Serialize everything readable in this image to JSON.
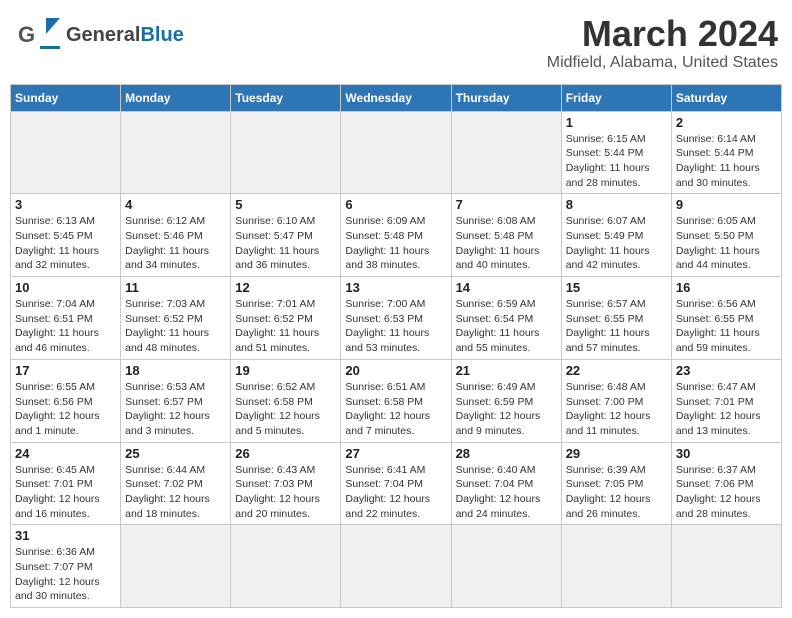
{
  "header": {
    "logo_general": "General",
    "logo_blue": "Blue",
    "month_title": "March 2024",
    "location": "Midfield, Alabama, United States"
  },
  "weekdays": [
    "Sunday",
    "Monday",
    "Tuesday",
    "Wednesday",
    "Thursday",
    "Friday",
    "Saturday"
  ],
  "weeks": [
    [
      {
        "day": "",
        "info": ""
      },
      {
        "day": "",
        "info": ""
      },
      {
        "day": "",
        "info": ""
      },
      {
        "day": "",
        "info": ""
      },
      {
        "day": "",
        "info": ""
      },
      {
        "day": "1",
        "info": "Sunrise: 6:15 AM\nSunset: 5:44 PM\nDaylight: 11 hours\nand 28 minutes."
      },
      {
        "day": "2",
        "info": "Sunrise: 6:14 AM\nSunset: 5:44 PM\nDaylight: 11 hours\nand 30 minutes."
      }
    ],
    [
      {
        "day": "3",
        "info": "Sunrise: 6:13 AM\nSunset: 5:45 PM\nDaylight: 11 hours\nand 32 minutes."
      },
      {
        "day": "4",
        "info": "Sunrise: 6:12 AM\nSunset: 5:46 PM\nDaylight: 11 hours\nand 34 minutes."
      },
      {
        "day": "5",
        "info": "Sunrise: 6:10 AM\nSunset: 5:47 PM\nDaylight: 11 hours\nand 36 minutes."
      },
      {
        "day": "6",
        "info": "Sunrise: 6:09 AM\nSunset: 5:48 PM\nDaylight: 11 hours\nand 38 minutes."
      },
      {
        "day": "7",
        "info": "Sunrise: 6:08 AM\nSunset: 5:48 PM\nDaylight: 11 hours\nand 40 minutes."
      },
      {
        "day": "8",
        "info": "Sunrise: 6:07 AM\nSunset: 5:49 PM\nDaylight: 11 hours\nand 42 minutes."
      },
      {
        "day": "9",
        "info": "Sunrise: 6:05 AM\nSunset: 5:50 PM\nDaylight: 11 hours\nand 44 minutes."
      }
    ],
    [
      {
        "day": "10",
        "info": "Sunrise: 7:04 AM\nSunset: 6:51 PM\nDaylight: 11 hours\nand 46 minutes."
      },
      {
        "day": "11",
        "info": "Sunrise: 7:03 AM\nSunset: 6:52 PM\nDaylight: 11 hours\nand 48 minutes."
      },
      {
        "day": "12",
        "info": "Sunrise: 7:01 AM\nSunset: 6:52 PM\nDaylight: 11 hours\nand 51 minutes."
      },
      {
        "day": "13",
        "info": "Sunrise: 7:00 AM\nSunset: 6:53 PM\nDaylight: 11 hours\nand 53 minutes."
      },
      {
        "day": "14",
        "info": "Sunrise: 6:59 AM\nSunset: 6:54 PM\nDaylight: 11 hours\nand 55 minutes."
      },
      {
        "day": "15",
        "info": "Sunrise: 6:57 AM\nSunset: 6:55 PM\nDaylight: 11 hours\nand 57 minutes."
      },
      {
        "day": "16",
        "info": "Sunrise: 6:56 AM\nSunset: 6:55 PM\nDaylight: 11 hours\nand 59 minutes."
      }
    ],
    [
      {
        "day": "17",
        "info": "Sunrise: 6:55 AM\nSunset: 6:56 PM\nDaylight: 12 hours\nand 1 minute."
      },
      {
        "day": "18",
        "info": "Sunrise: 6:53 AM\nSunset: 6:57 PM\nDaylight: 12 hours\nand 3 minutes."
      },
      {
        "day": "19",
        "info": "Sunrise: 6:52 AM\nSunset: 6:58 PM\nDaylight: 12 hours\nand 5 minutes."
      },
      {
        "day": "20",
        "info": "Sunrise: 6:51 AM\nSunset: 6:58 PM\nDaylight: 12 hours\nand 7 minutes."
      },
      {
        "day": "21",
        "info": "Sunrise: 6:49 AM\nSunset: 6:59 PM\nDaylight: 12 hours\nand 9 minutes."
      },
      {
        "day": "22",
        "info": "Sunrise: 6:48 AM\nSunset: 7:00 PM\nDaylight: 12 hours\nand 11 minutes."
      },
      {
        "day": "23",
        "info": "Sunrise: 6:47 AM\nSunset: 7:01 PM\nDaylight: 12 hours\nand 13 minutes."
      }
    ],
    [
      {
        "day": "24",
        "info": "Sunrise: 6:45 AM\nSunset: 7:01 PM\nDaylight: 12 hours\nand 16 minutes."
      },
      {
        "day": "25",
        "info": "Sunrise: 6:44 AM\nSunset: 7:02 PM\nDaylight: 12 hours\nand 18 minutes."
      },
      {
        "day": "26",
        "info": "Sunrise: 6:43 AM\nSunset: 7:03 PM\nDaylight: 12 hours\nand 20 minutes."
      },
      {
        "day": "27",
        "info": "Sunrise: 6:41 AM\nSunset: 7:04 PM\nDaylight: 12 hours\nand 22 minutes."
      },
      {
        "day": "28",
        "info": "Sunrise: 6:40 AM\nSunset: 7:04 PM\nDaylight: 12 hours\nand 24 minutes."
      },
      {
        "day": "29",
        "info": "Sunrise: 6:39 AM\nSunset: 7:05 PM\nDaylight: 12 hours\nand 26 minutes."
      },
      {
        "day": "30",
        "info": "Sunrise: 6:37 AM\nSunset: 7:06 PM\nDaylight: 12 hours\nand 28 minutes."
      }
    ],
    [
      {
        "day": "31",
        "info": "Sunrise: 6:36 AM\nSunset: 7:07 PM\nDaylight: 12 hours\nand 30 minutes."
      },
      {
        "day": "",
        "info": ""
      },
      {
        "day": "",
        "info": ""
      },
      {
        "day": "",
        "info": ""
      },
      {
        "day": "",
        "info": ""
      },
      {
        "day": "",
        "info": ""
      },
      {
        "day": "",
        "info": ""
      }
    ]
  ]
}
